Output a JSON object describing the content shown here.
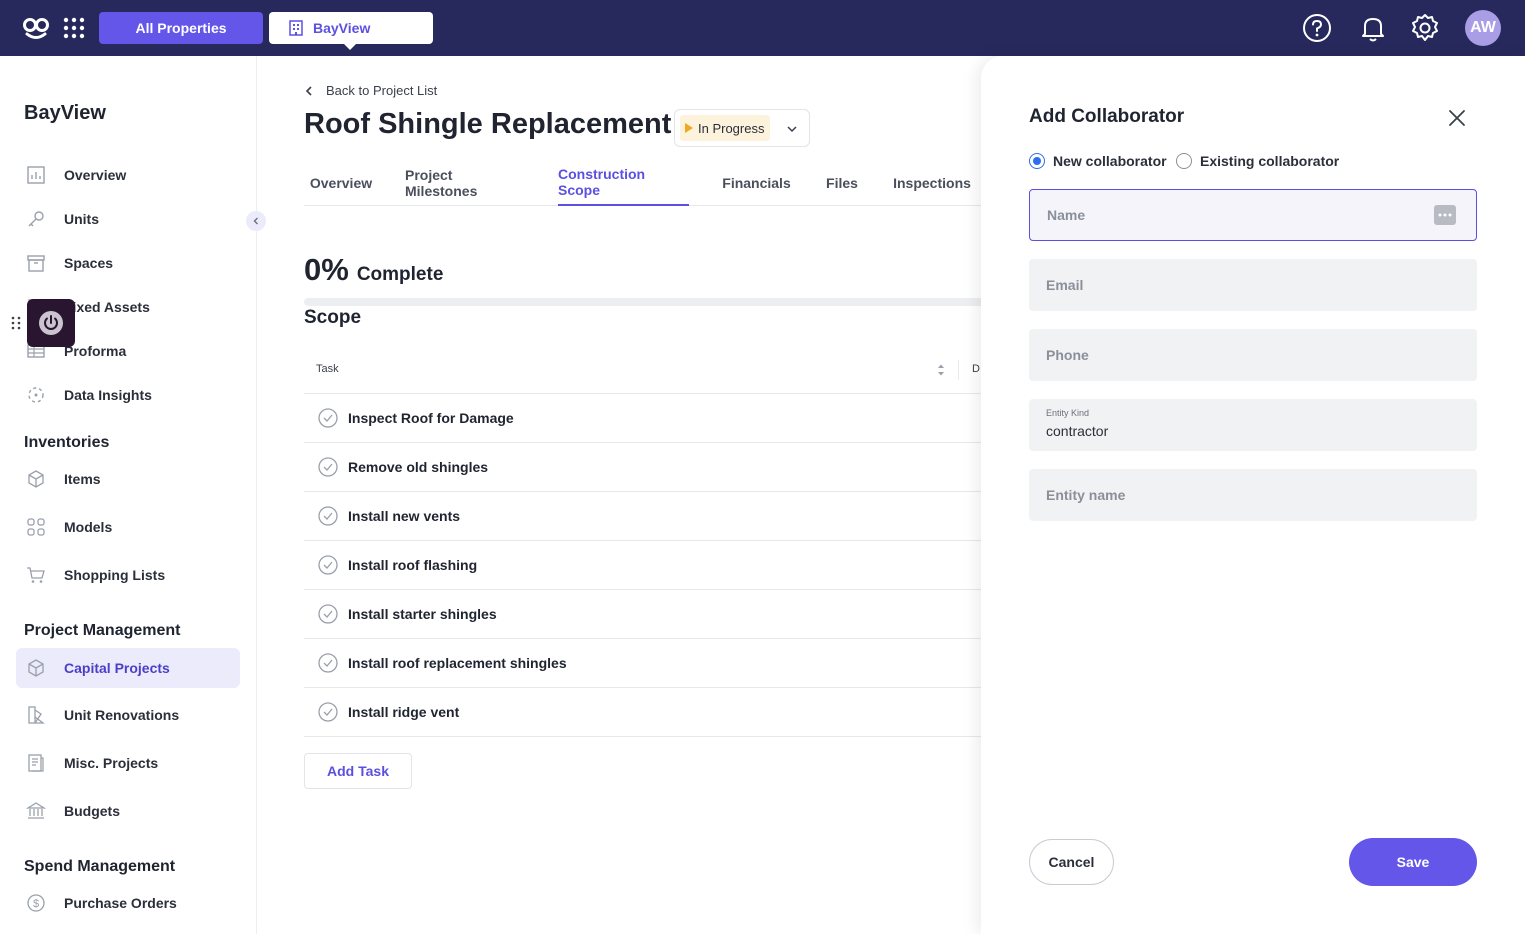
{
  "topbar": {
    "all_properties": "All Properties",
    "property_tab": "BayView",
    "avatar_initials": "AW"
  },
  "sidebar": {
    "property_name": "BayView",
    "items": [
      {
        "label": "Overview",
        "icon": "chart-icon"
      },
      {
        "label": "Units",
        "icon": "key-icon"
      },
      {
        "label": "Spaces",
        "icon": "box-icon"
      },
      {
        "label": "Fixed Assets",
        "icon": "asset-icon"
      },
      {
        "label": "Proforma",
        "icon": "table-icon"
      },
      {
        "label": "Data Insights",
        "icon": "insights-icon"
      }
    ],
    "inventories_title": "Inventories",
    "inventories": [
      {
        "label": "Items",
        "icon": "cube-icon"
      },
      {
        "label": "Models",
        "icon": "grid-icon"
      },
      {
        "label": "Shopping Lists",
        "icon": "cart-icon"
      }
    ],
    "project_title": "Project Management",
    "projects": [
      {
        "label": "Capital Projects",
        "icon": "cube-icon"
      },
      {
        "label": "Unit Renovations",
        "icon": "paint-icon"
      },
      {
        "label": "Misc. Projects",
        "icon": "doc-icon"
      },
      {
        "label": "Budgets",
        "icon": "bank-icon"
      }
    ],
    "spend_title": "Spend Management",
    "spend": [
      {
        "label": "Purchase Orders",
        "icon": "dollar-icon"
      }
    ]
  },
  "main": {
    "back_label": "Back to Project List",
    "title": "Roof Shingle Replacement",
    "status": "In Progress",
    "tabs": [
      "Overview",
      "Project Milestones",
      "Construction Scope",
      "Financials",
      "Files",
      "Inspections"
    ],
    "active_tab": "Construction Scope",
    "percent": "0%",
    "percent_label": "Complete",
    "progress_fraction": 0,
    "scope_title": "Scope",
    "table_headers": {
      "task": "Task",
      "second": "D"
    },
    "tasks": [
      "Inspect Roof for Damage",
      "Remove old shingles",
      "Install new vents",
      "Install roof flashing",
      "Install starter shingles",
      "Install roof replacement shingles",
      "Install ridge vent"
    ],
    "add_task": "Add Task"
  },
  "panel": {
    "title": "Add Collaborator",
    "radio_new": "New collaborator",
    "radio_existing": "Existing collaborator",
    "selected_radio": "new",
    "fields": {
      "name_placeholder": "Name",
      "email_placeholder": "Email",
      "phone_placeholder": "Phone",
      "entity_kind_label": "Entity Kind",
      "entity_kind_value": "contractor",
      "entity_name_placeholder": "Entity name"
    },
    "cancel": "Cancel",
    "save": "Save"
  },
  "colors": {
    "topbar": "#27295c",
    "accent": "#6356e8",
    "active_nav_bg": "#ecebfb",
    "status_bg": "#fdf3dd",
    "radio_selected": "#2d6df0"
  }
}
